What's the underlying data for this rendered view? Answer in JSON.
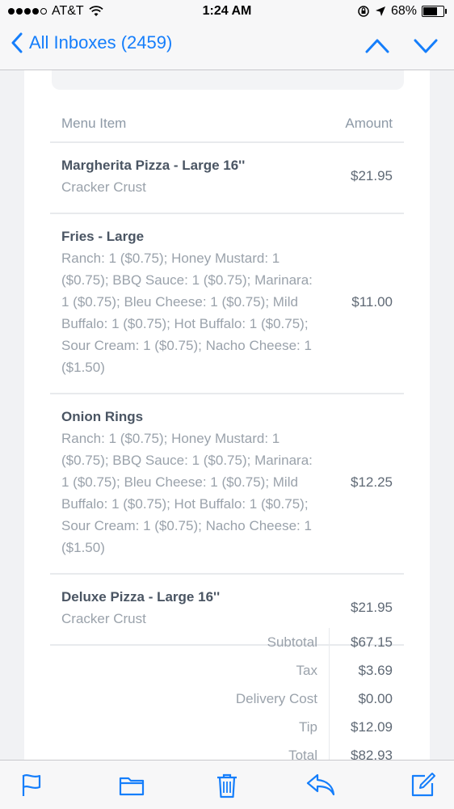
{
  "status_bar": {
    "carrier": "AT&T",
    "time": "1:24 AM",
    "battery": "68%",
    "signal_dots": 5,
    "signal_filled": 4,
    "battery_level": 0.68
  },
  "nav": {
    "back_label": "All Inboxes (2459)"
  },
  "order_table": {
    "col_item": "Menu Item",
    "col_amount": "Amount",
    "rows": [
      {
        "name": "Margherita Pizza - Large 16''",
        "desc": "Cracker Crust",
        "amount": "$21.95"
      },
      {
        "name": "Fries - Large",
        "desc": "Ranch: 1 ($0.75); Honey Mustard: 1 ($0.75); BBQ Sauce: 1 ($0.75); Marinara: 1 ($0.75); Bleu Cheese: 1 ($0.75); Mild Buffalo: 1 ($0.75); Hot Buffalo: 1 ($0.75); Sour Cream: 1 ($0.75); Nacho Cheese: 1 ($1.50)",
        "amount": "$11.00"
      },
      {
        "name": "Onion Rings",
        "desc": "Ranch: 1 ($0.75); Honey Mustard: 1 ($0.75); BBQ Sauce: 1 ($0.75); Marinara: 1 ($0.75); Bleu Cheese: 1 ($0.75); Mild Buffalo: 1 ($0.75); Hot Buffalo: 1 ($0.75); Sour Cream: 1 ($0.75); Nacho Cheese: 1 ($1.50)",
        "amount": "$12.25"
      },
      {
        "name": "Deluxe Pizza - Large 16''",
        "desc": "Cracker Crust",
        "amount": "$21.95"
      }
    ]
  },
  "totals": {
    "rows": [
      {
        "label": "Subtotal",
        "value": "$67.15"
      },
      {
        "label": "Tax",
        "value": "$3.69"
      },
      {
        "label": "Delivery Cost",
        "value": "$0.00"
      },
      {
        "label": "Tip",
        "value": "$12.09"
      },
      {
        "label": "Total",
        "value": "$82.93"
      }
    ]
  },
  "toolbar": {
    "icons": [
      "flag-icon",
      "folder-icon",
      "trash-icon",
      "reply-icon",
      "compose-icon"
    ]
  },
  "colors": {
    "accent": "#157efb",
    "item_name": "#4a5563",
    "item_desc": "#9aa2ab",
    "divider": "#e8eaed"
  }
}
